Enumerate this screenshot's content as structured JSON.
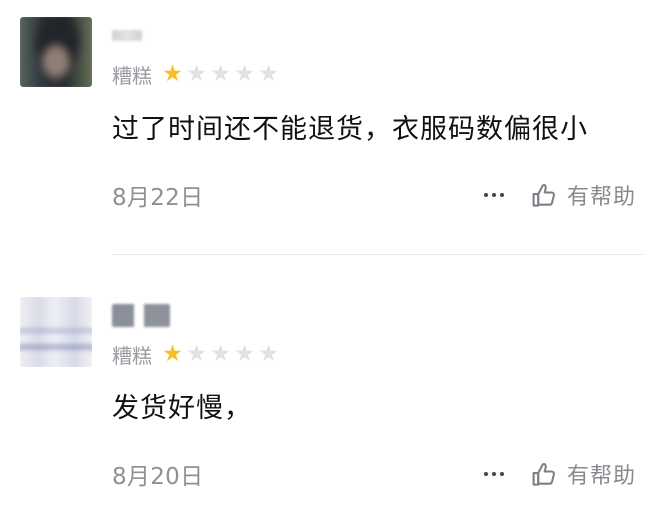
{
  "reviews": [
    {
      "rating_label": "糟糕",
      "stars_filled": 1,
      "stars_total": 5,
      "comment": "过了时间还不能退货，衣服码数偏很小",
      "date": "8月22日",
      "helpful_label": "有帮助"
    },
    {
      "rating_label": "糟糕",
      "stars_filled": 1,
      "stars_total": 5,
      "comment": "发货好慢，",
      "date": "8月20日",
      "helpful_label": "有帮助"
    }
  ],
  "colors": {
    "star_filled": "#f7bf24",
    "star_empty": "#e0e1e4",
    "muted_text": "#8e9096"
  },
  "icons": {
    "more": "more-icon",
    "helpful": "thumb-up-icon"
  }
}
